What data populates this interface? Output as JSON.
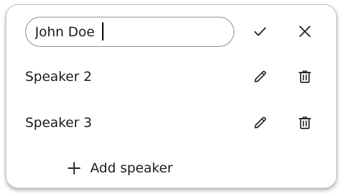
{
  "speaker_editor": {
    "editing_row": {
      "input_value": "John Doe",
      "confirm_icon": "check-icon",
      "cancel_icon": "close-icon"
    },
    "speakers": [
      {
        "label": "Speaker 2",
        "edit_icon": "pencil-icon",
        "delete_icon": "trash-icon"
      },
      {
        "label": "Speaker 3",
        "edit_icon": "pencil-icon",
        "delete_icon": "trash-icon"
      }
    ],
    "add_button": {
      "label": "Add speaker",
      "icon": "plus-icon"
    }
  },
  "colors": {
    "text": "#1b1b1b",
    "icon": "#222222",
    "input_border": "#8e8e8e",
    "card_border": "#bdbdbd"
  }
}
